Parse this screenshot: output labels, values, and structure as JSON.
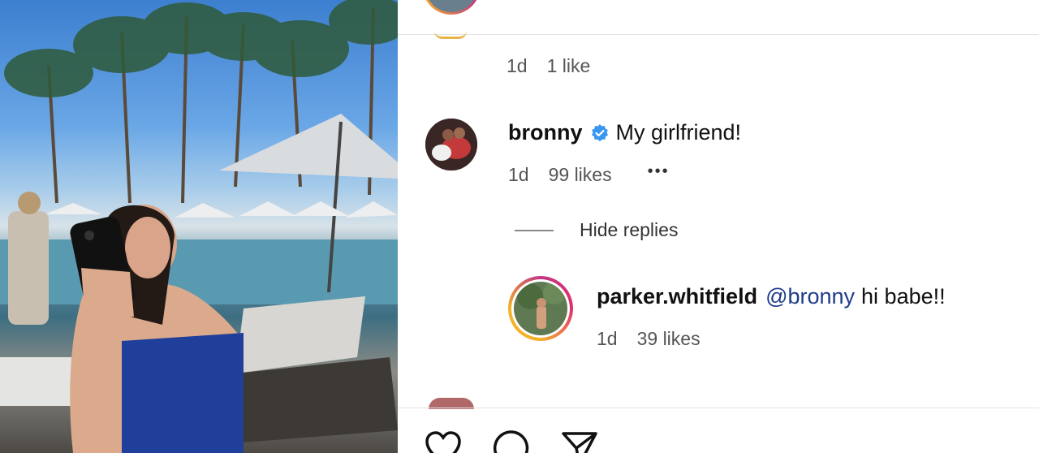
{
  "photo": {
    "alt_icon": "post-photo"
  },
  "comments": {
    "prev_meta": {
      "time": "1d",
      "likes": "1 like"
    },
    "main": {
      "username": "bronny",
      "text": "My girlfriend!",
      "time": "1d",
      "likes": "99 likes",
      "more": "•••"
    },
    "hide_replies": "Hide replies",
    "reply": {
      "username": "parker.whitfield",
      "mention": "@bronny",
      "text": "hi babe!!",
      "time": "1d",
      "likes": "39 likes"
    }
  },
  "actions": [
    "heart-icon",
    "comment-icon",
    "share-icon"
  ],
  "colors": {
    "verified": "#3897f0",
    "ring": "#c13584",
    "ring2": "#f5b12a"
  }
}
